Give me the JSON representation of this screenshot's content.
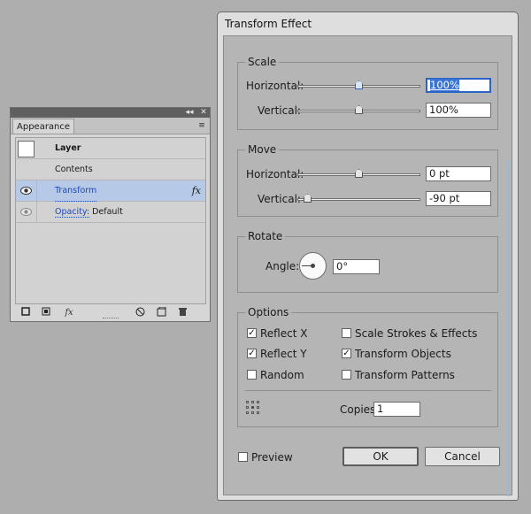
{
  "appearance_panel": {
    "tab_label": "Appearance",
    "collapse_glyph": "◂◂",
    "close_glyph": "✕",
    "menu_glyph": "≡",
    "rows": {
      "layer": {
        "label": "Layer"
      },
      "contents": {
        "label": "Contents"
      },
      "transform": {
        "label": "Transform",
        "fx": "fx",
        "eye_icon": "eye-icon"
      },
      "opacity": {
        "label": "Opacity:",
        "value": "Default",
        "eye_icon": "eye-icon"
      }
    },
    "bottom_icons": [
      "add-new-stroke-icon",
      "add-new-fill-icon",
      "add-new-effect-icon",
      "clear-appearance-icon",
      "duplicate-item-icon",
      "delete-item-icon"
    ],
    "bottom_fx": "fx"
  },
  "dialog": {
    "title": "Transform Effect",
    "scale": {
      "legend": "Scale",
      "horizontal_label": "Horizontal:",
      "horizontal_value": "100%",
      "horizontal_slider_fraction": 0.5,
      "vertical_label": "Vertical:",
      "vertical_value": "100%",
      "vertical_slider_fraction": 0.5
    },
    "move": {
      "legend": "Move",
      "horizontal_label": "Horizontal:",
      "horizontal_value": "0 pt",
      "horizontal_slider_fraction": 0.5,
      "vertical_label": "Vertical:",
      "vertical_value": "-90 pt",
      "vertical_slider_fraction": 0.08
    },
    "rotate": {
      "legend": "Rotate",
      "angle_label": "Angle:",
      "angle_value": "0°"
    },
    "options": {
      "legend": "Options",
      "reflect_x": {
        "label": "Reflect X",
        "checked": true
      },
      "reflect_y": {
        "label": "Reflect Y",
        "checked": true
      },
      "random": {
        "label": "Random",
        "checked": false
      },
      "scale_strokes": {
        "label": "Scale Strokes & Effects",
        "checked": false
      },
      "transform_objects": {
        "label": "Transform Objects",
        "checked": true
      },
      "transform_patterns": {
        "label": "Transform Patterns",
        "checked": false
      },
      "copies_label": "Copies",
      "copies_value": "1"
    },
    "preview": {
      "label": "Preview",
      "checked": false
    },
    "ok_label": "OK",
    "cancel_label": "Cancel",
    "check_glyph": "✓"
  }
}
